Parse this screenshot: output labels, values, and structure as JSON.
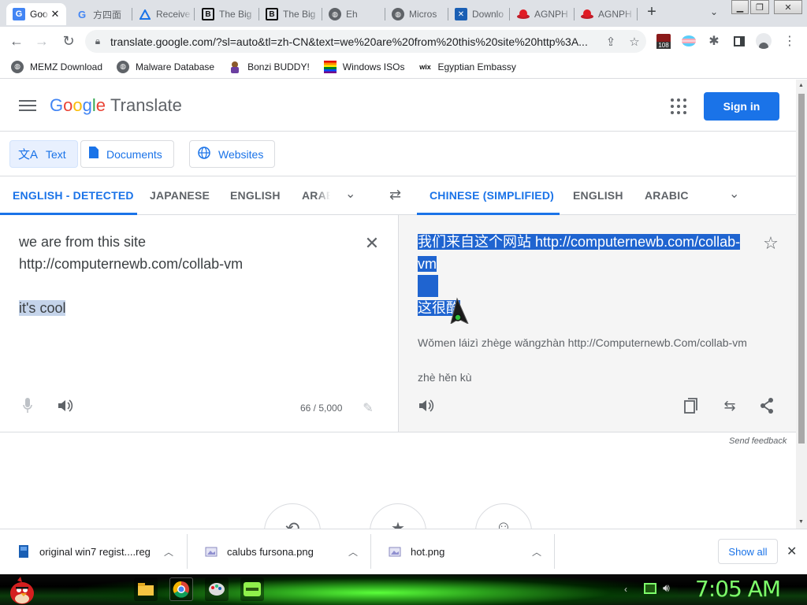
{
  "browser": {
    "tabs": [
      {
        "title": "Goo",
        "icon": "google-translate-icon",
        "active": true
      },
      {
        "title": "方四面",
        "icon": "google-icon"
      },
      {
        "title": "Receive",
        "icon": "triangle-icon"
      },
      {
        "title": "The Big",
        "icon": "b-logo-icon"
      },
      {
        "title": "The Big",
        "icon": "b-logo-icon"
      },
      {
        "title": "Eh",
        "icon": "globe-icon"
      },
      {
        "title": "Micros",
        "icon": "globe-icon"
      },
      {
        "title": "Downlo",
        "icon": "download-site-icon"
      },
      {
        "title": "AGNPH",
        "icon": "red-hat-icon"
      },
      {
        "title": "AGNPH",
        "icon": "red-hat-icon"
      }
    ],
    "new_tab": "+",
    "tab_close": "✕",
    "url": "translate.google.com/?sl=auto&tl=zh-CN&text=we%20are%20from%20this%20site%20http%3A...",
    "extension_badge": "108",
    "bookmarks": [
      {
        "label": "MEMZ Download",
        "icon": "globe-icon"
      },
      {
        "label": "Malware Database",
        "icon": "globe-icon"
      },
      {
        "label": "Bonzi BUDDY!",
        "icon": "bonzi-icon"
      },
      {
        "label": "Windows ISOs",
        "icon": "windows-flag-icon"
      },
      {
        "label": "Egyptian Embassy",
        "icon": "wix-icon"
      }
    ]
  },
  "translate": {
    "logo": [
      "G",
      "o",
      "o",
      "g",
      "l",
      "e"
    ],
    "logo_colors": [
      "#4285f4",
      "#ea4335",
      "#fbbc05",
      "#4285f4",
      "#34a853",
      "#ea4335"
    ],
    "product": "Translate",
    "sign_in": "Sign in",
    "modes": [
      {
        "label": "Text",
        "selected": true
      },
      {
        "label": "Documents"
      },
      {
        "label": "Websites"
      }
    ],
    "source_langs": [
      "ENGLISH - DETECTED",
      "JAPANESE",
      "ENGLISH",
      "ARAB"
    ],
    "target_langs": [
      "CHINESE (SIMPLIFIED)",
      "ENGLISH",
      "ARABIC"
    ],
    "source_text": {
      "line1": "we are from this site",
      "line2": "http://computernewb.com/collab-vm",
      "line3": "it's cool"
    },
    "char_count": "66 / 5,000",
    "translation": {
      "line1": "我们来自这个网站 http://computernewb.com/collab-",
      "line2": "vm",
      "line3": "这很酷",
      "romanization1": "Wǒmen láizì zhège wǎngzhàn http://Computernewb.Com/collab-vm",
      "romanization2": "zhè hěn kù"
    },
    "send_feedback": "Send feedback"
  },
  "downloads": {
    "items": [
      "original win7 regist....reg",
      "calubs fursona.png",
      "hot.png"
    ],
    "show_all": "Show all"
  },
  "taskbar": {
    "clock": "7:05 AM"
  },
  "colors": {
    "accent": "#1a73e8",
    "selection": "#1f64d0",
    "clock": "#7dff6a"
  }
}
